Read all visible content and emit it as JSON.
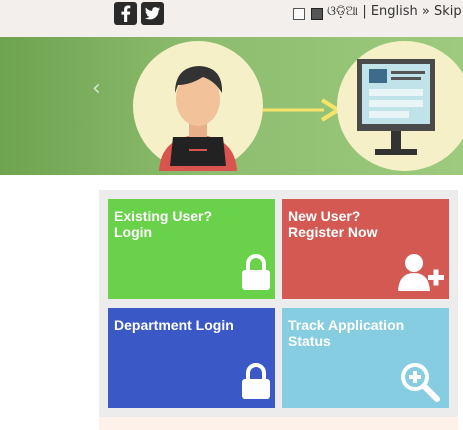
{
  "header": {
    "social": {
      "facebook_icon": "facebook-icon",
      "twitter_icon": "twitter-icon"
    },
    "lang_odia": "ଓଡ଼ିଆ",
    "separator": " | ",
    "lang_english": "English",
    "skip_link": " » Skip t"
  },
  "banner": {
    "prev_arrow": "‹"
  },
  "tiles": [
    {
      "title_line1": "Existing User?",
      "title_line2": "Login",
      "icon": "lock-icon",
      "color": "#6ad24a"
    },
    {
      "title_line1": "New User?",
      "title_line2": "Register Now",
      "icon": "add-user-icon",
      "color": "#d35952"
    },
    {
      "title_line1": "Department Login",
      "title_line2": "",
      "icon": "lock-icon",
      "color": "#3b59c6"
    },
    {
      "title_line1": "Track Application",
      "title_line2": "Status",
      "icon": "zoom-in-icon",
      "color": "#86cde2"
    }
  ]
}
